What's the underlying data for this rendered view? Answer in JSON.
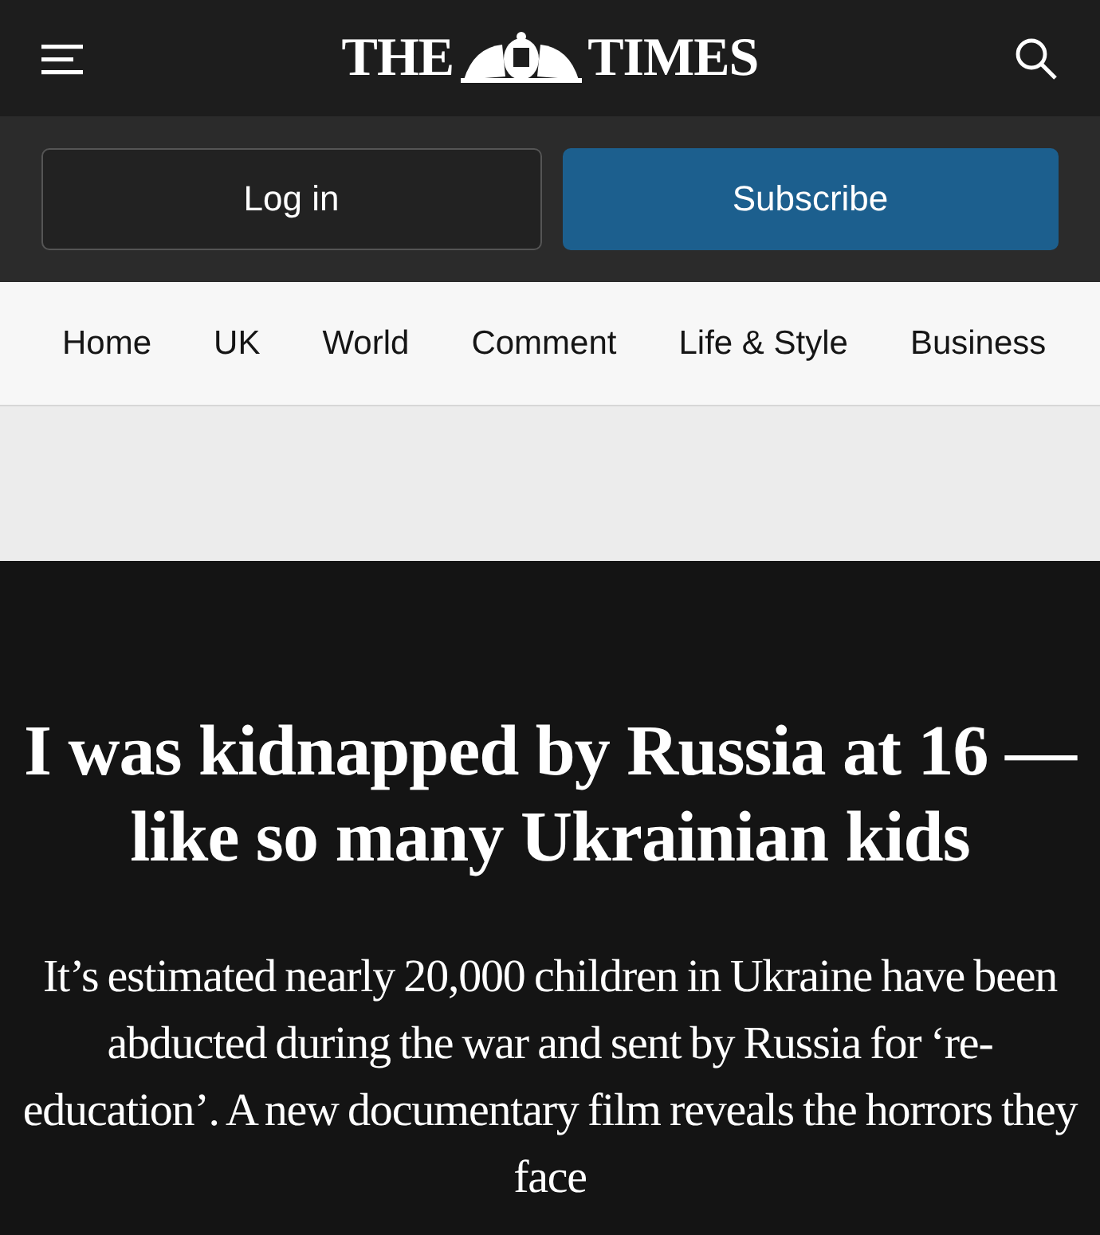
{
  "header": {
    "logo_left": "THE",
    "logo_right": "TIMES"
  },
  "account": {
    "login": "Log in",
    "subscribe": "Subscribe"
  },
  "nav": [
    {
      "label": "Home"
    },
    {
      "label": "UK"
    },
    {
      "label": "World"
    },
    {
      "label": "Comment"
    },
    {
      "label": "Life & Style"
    },
    {
      "label": "Business"
    }
  ],
  "article": {
    "headline": "I was kidnapped by Russia at 16 — like so many Ukrainian kids",
    "standfirst": "It’s estimated nearly 20,000 children in Ukraine have been abducted during the war and sent by Russia for ‘re-education’. A new documentary film reveals the horrors they face"
  }
}
